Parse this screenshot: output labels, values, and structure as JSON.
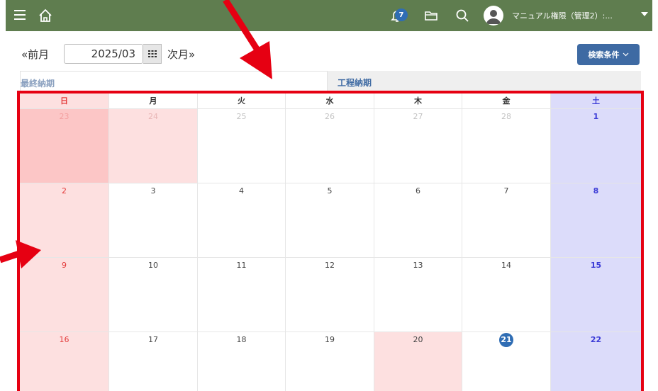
{
  "header": {
    "notification_count": "7",
    "user_name": "マニュアル権限（管理2）:..."
  },
  "nav": {
    "prev_label": "«前月",
    "month_value": "2025/03",
    "next_label": "次月»",
    "search_conditions_label": "検索条件"
  },
  "tabs": [
    {
      "label": "最終納期"
    },
    {
      "label": "工程納期"
    }
  ],
  "calendar": {
    "weekdays": [
      "日",
      "月",
      "火",
      "水",
      "木",
      "金",
      "土"
    ],
    "weeks": [
      [
        "23",
        "24",
        "25",
        "26",
        "27",
        "28",
        "1"
      ],
      [
        "2",
        "3",
        "4",
        "5",
        "6",
        "7",
        "8"
      ],
      [
        "9",
        "10",
        "11",
        "12",
        "13",
        "14",
        "15"
      ],
      [
        "16",
        "17",
        "18",
        "19",
        "20",
        "21",
        "22"
      ]
    ],
    "today": "21"
  },
  "colors": {
    "topbar": "#5f7d4f",
    "accent_blue": "#3e6aa3",
    "highlight_red": "#e60012",
    "sunday_bg": "#fde0e0",
    "saturday_bg": "#dcdcfa"
  },
  "icons": [
    "hamburger-icon",
    "home-icon",
    "bell-icon",
    "folder-icon",
    "search-icon",
    "user-avatar-icon",
    "dropdown-caret-icon",
    "calendar-picker-icon",
    "chevron-down-icon"
  ]
}
